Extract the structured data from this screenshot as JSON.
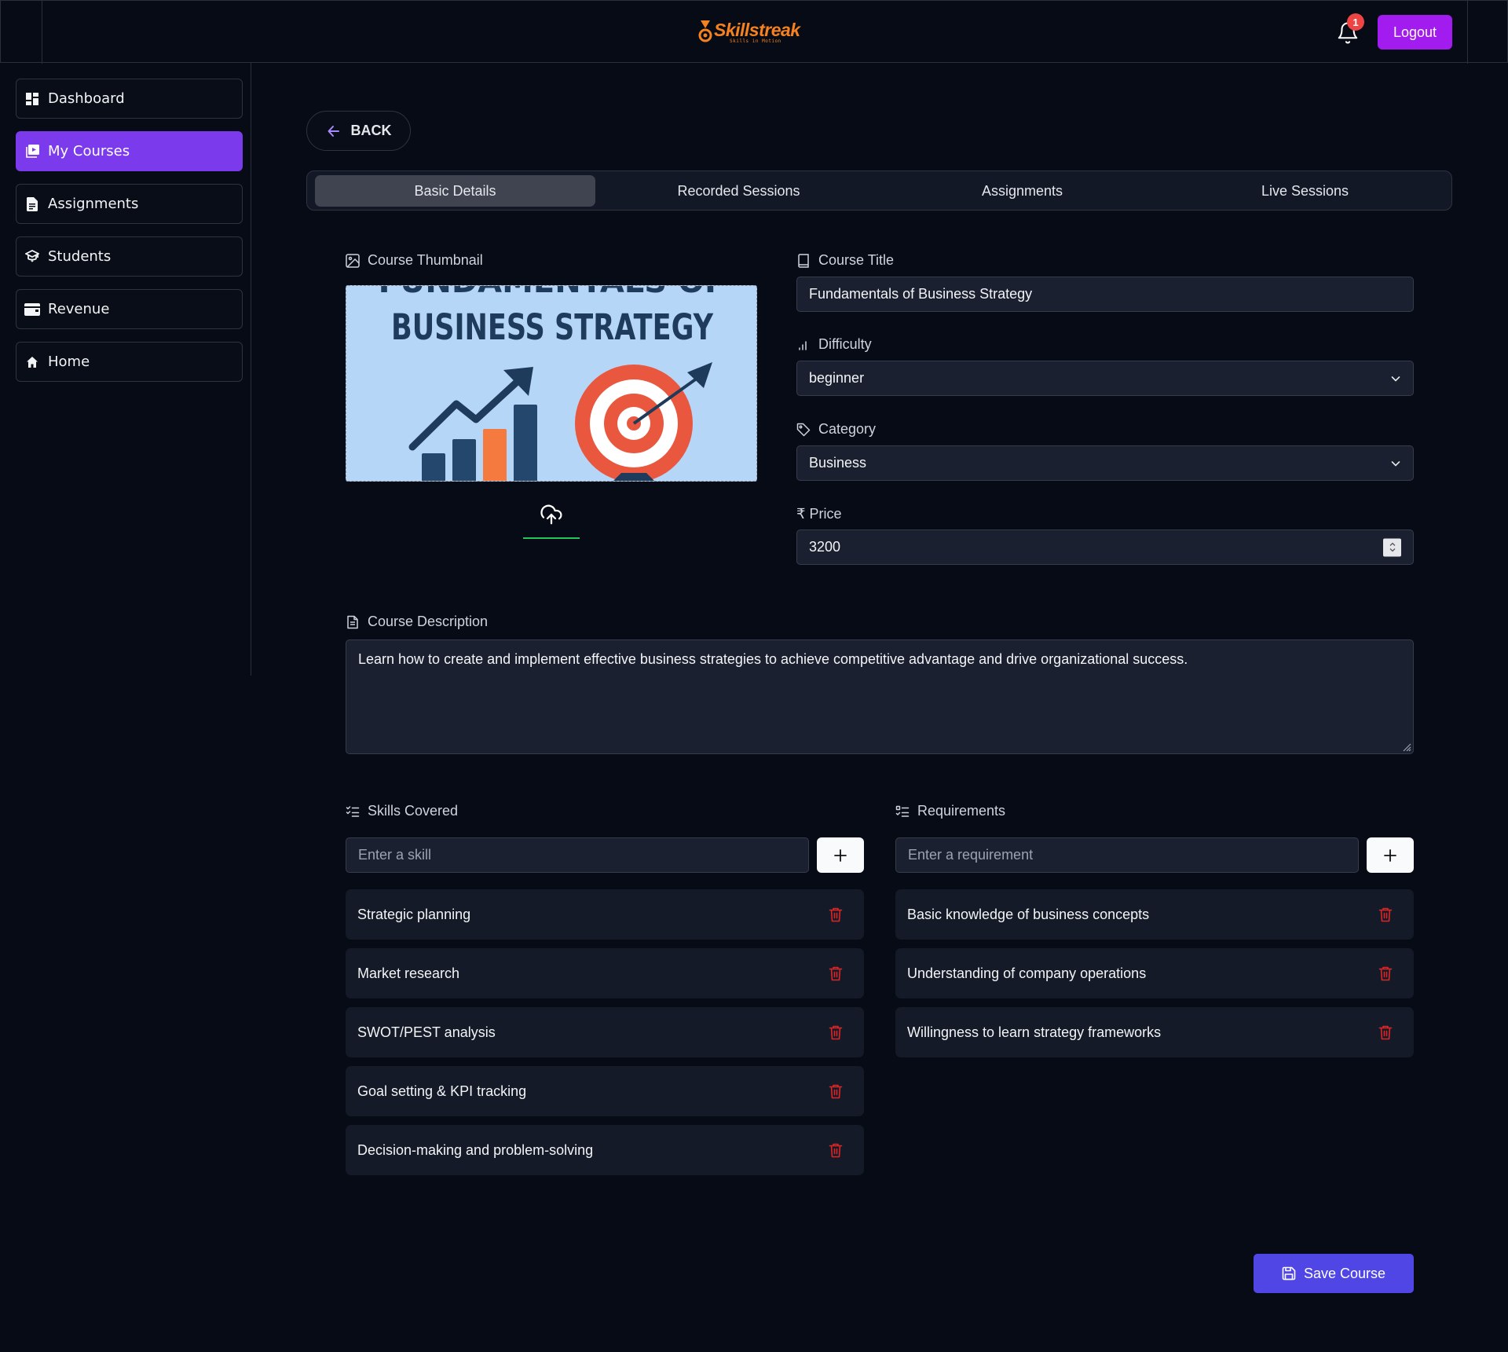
{
  "header": {
    "brand": "Skillstreak",
    "tagline": "Skills in Motion",
    "notification_count": "1",
    "logout_label": "Logout"
  },
  "sidebar": {
    "items": [
      {
        "label": "Dashboard",
        "icon": "dashboard-icon"
      },
      {
        "label": "My Courses",
        "icon": "video-icon",
        "active": true
      },
      {
        "label": "Assignments",
        "icon": "document-icon"
      },
      {
        "label": "Students",
        "icon": "graduation-cap-icon"
      },
      {
        "label": "Revenue",
        "icon": "wallet-icon"
      },
      {
        "label": "Home",
        "icon": "home-icon"
      }
    ]
  },
  "main": {
    "back_label": "BACK",
    "tabs": [
      {
        "label": "Basic Details",
        "active": true
      },
      {
        "label": "Recorded Sessions"
      },
      {
        "label": "Assignments"
      },
      {
        "label": "Live Sessions"
      }
    ],
    "thumbnail": {
      "label": "Course Thumbnail",
      "image_text_top": "FUNDAMENTALS OF",
      "image_text_main": "BUSINESS STRATEGY"
    },
    "title": {
      "label": "Course Title",
      "value": "Fundamentals of Business Strategy"
    },
    "difficulty": {
      "label": "Difficulty",
      "value": "beginner"
    },
    "category": {
      "label": "Category",
      "value": "Business"
    },
    "price": {
      "label": "₹ Price",
      "value": "3200"
    },
    "description": {
      "label": "Course Description",
      "value": "Learn how to create and implement effective business strategies to achieve competitive advantage and drive organizational success."
    },
    "skills": {
      "label": "Skills Covered",
      "placeholder": "Enter a skill",
      "items": [
        "Strategic planning",
        "Market research",
        "SWOT/PEST analysis",
        "Goal setting & KPI tracking",
        "Decision-making and problem-solving"
      ]
    },
    "requirements": {
      "label": "Requirements",
      "placeholder": "Enter a requirement",
      "items": [
        "Basic knowledge of business concepts",
        "Understanding of company operations",
        "Willingness to learn strategy frameworks"
      ]
    },
    "save_label": "Save Course"
  },
  "colors": {
    "accent": "#7c3aed",
    "logout": "#a21cf0",
    "save": "#4f46e5",
    "brand": "#f5821f",
    "danger": "#ef4444",
    "background": "#070b16"
  }
}
